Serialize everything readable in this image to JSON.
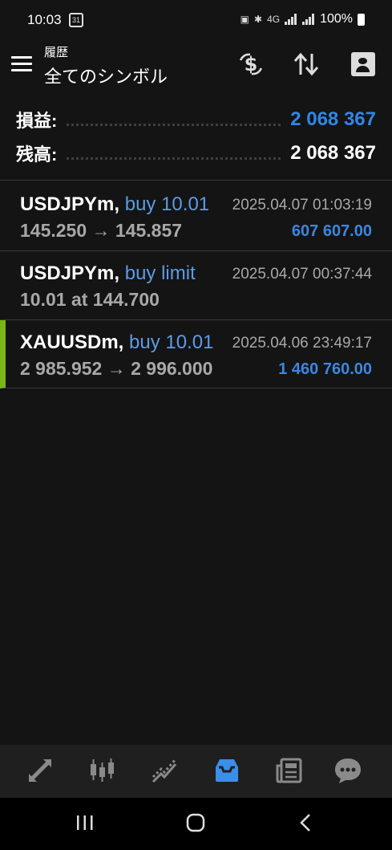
{
  "status_bar": {
    "time": "10:03",
    "calendar_day": "31",
    "network": "4G",
    "battery": "100%"
  },
  "header": {
    "subtitle": "履歴",
    "title": "全てのシンボル"
  },
  "summary": {
    "profit_label": "損益:",
    "profit_value": "2 068 367",
    "balance_label": "残高:",
    "balance_value": "2 068 367"
  },
  "deals": [
    {
      "symbol": "USDJPYm,",
      "type": "buy 10.01",
      "prices": "145.250 → 145.857",
      "time": "2025.04.07 01:03:19",
      "profit": "607 607.00"
    },
    {
      "symbol": "USDJPYm,",
      "type": "buy limit",
      "prices": "10.01 at 144.700",
      "time": "2025.04.07 00:37:44",
      "profit": ""
    },
    {
      "symbol": "XAUUSDm,",
      "type": "buy 10.01",
      "prices": "2 985.952 → 2 996.000",
      "time": "2025.04.06 23:49:17",
      "profit": "1 460 760.00"
    }
  ],
  "colors": {
    "background": "#141414",
    "accent_blue": "#2f86e8",
    "type_blue": "#5b9be6",
    "highlight_green": "#7cb518",
    "muted_text": "#a8a8a8"
  },
  "tabs": [
    {
      "icon": "quotes-icon",
      "active": false
    },
    {
      "icon": "chart-icon",
      "active": false
    },
    {
      "icon": "trade-icon",
      "active": false
    },
    {
      "icon": "history-icon",
      "active": true
    },
    {
      "icon": "news-icon",
      "active": false
    },
    {
      "icon": "messages-icon",
      "active": false
    }
  ]
}
